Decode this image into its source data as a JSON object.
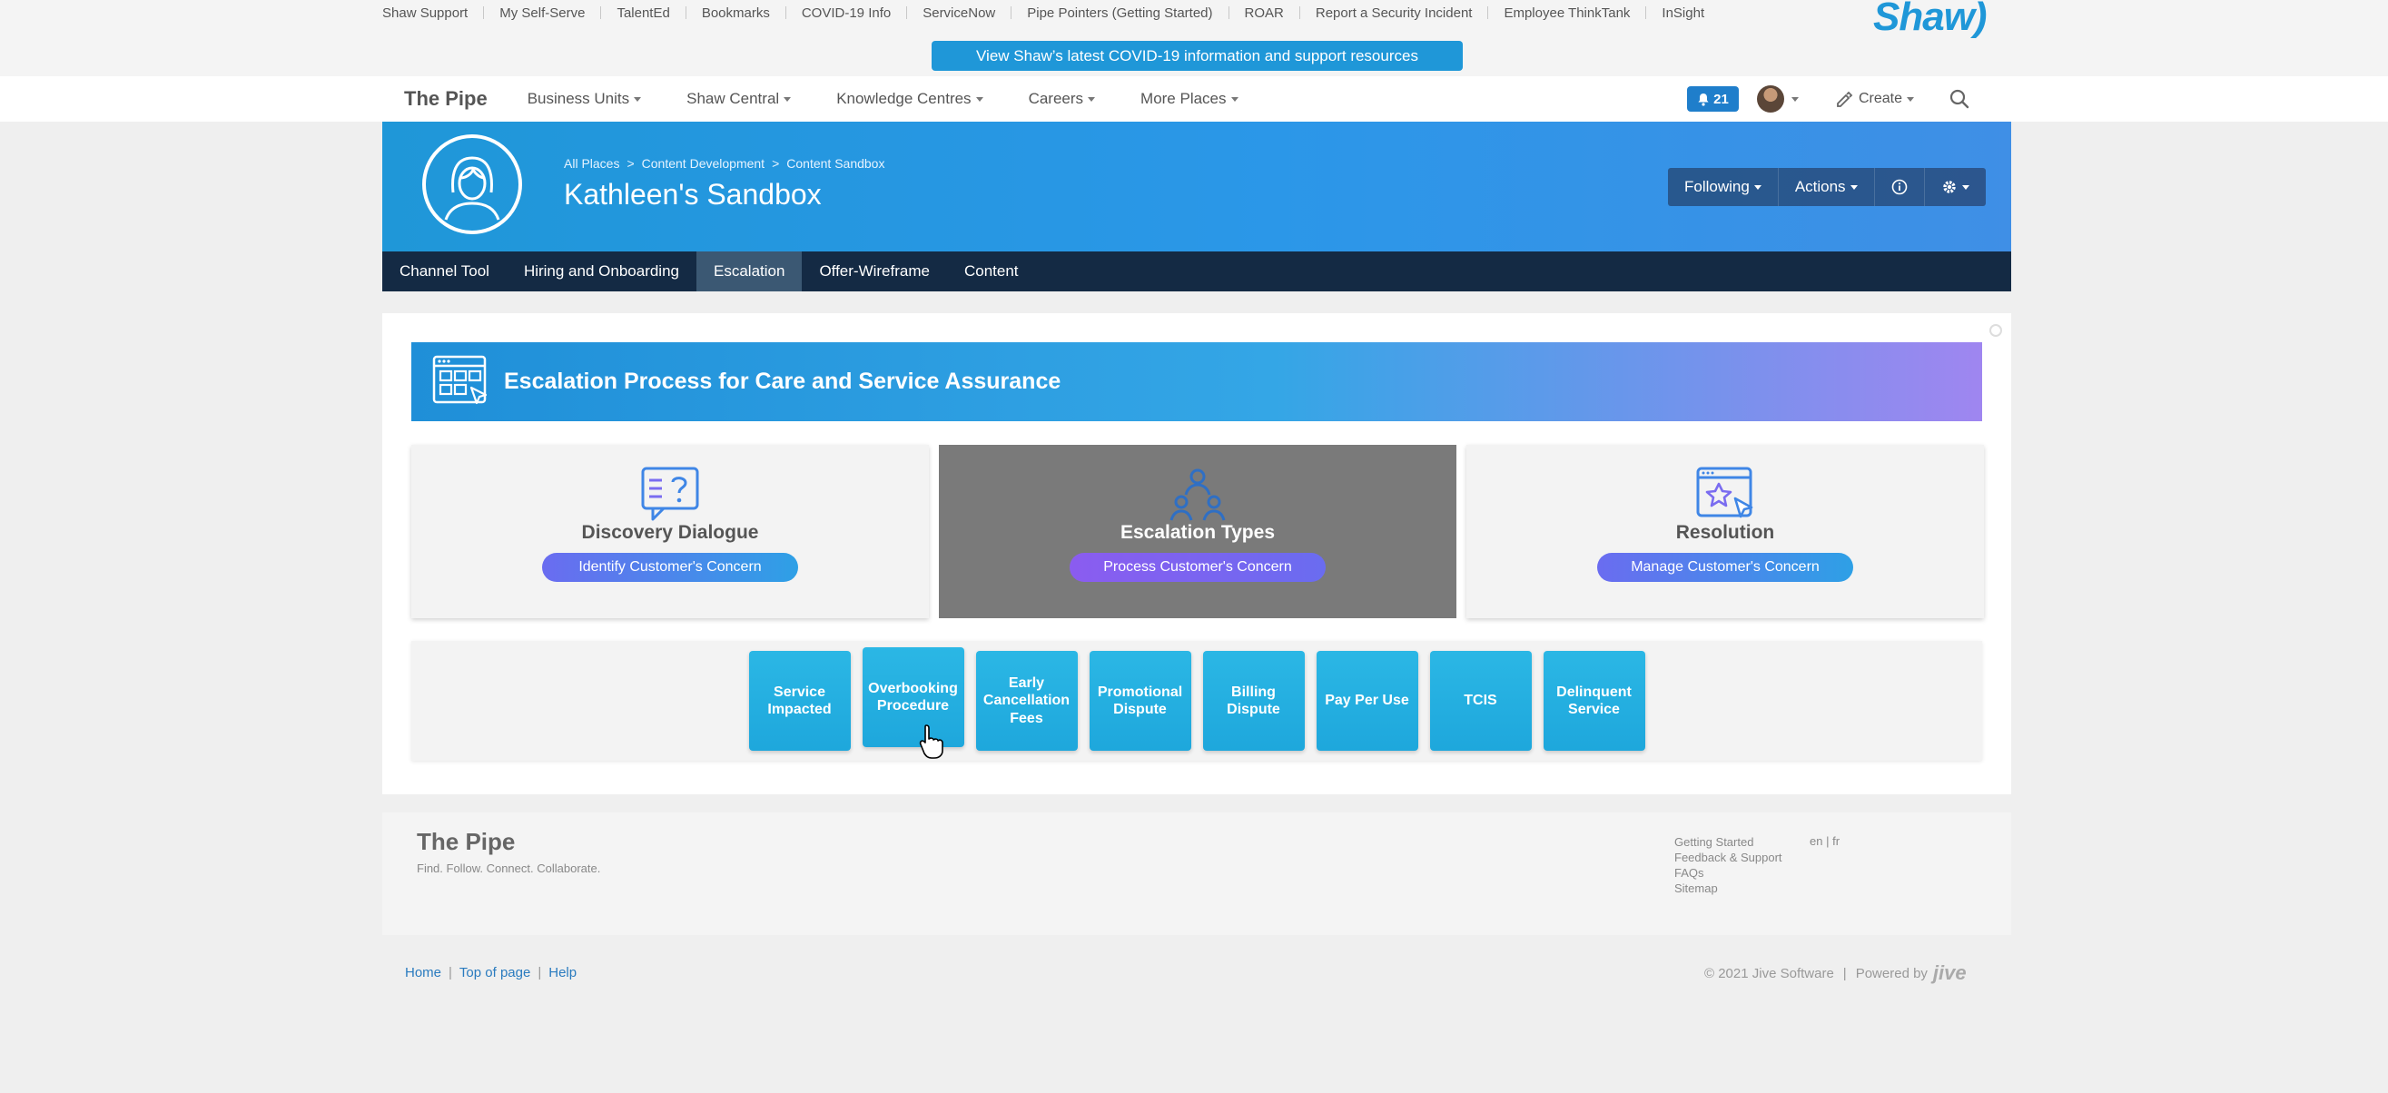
{
  "utility_links": [
    "Shaw Support",
    "My Self-Serve",
    "TalentEd",
    "Bookmarks",
    "COVID-19 Info",
    "ServiceNow",
    "Pipe Pointers (Getting Started)",
    "ROAR",
    "Report a Security Incident",
    "Employee ThinkTank",
    "InSight"
  ],
  "logo_text": "Shaw)",
  "covid_banner": "View Shaw’s latest COVID-19 information and support resources",
  "nav": {
    "brand": "The Pipe",
    "items": [
      "Business Units",
      "Shaw Central",
      "Knowledge Centres",
      "Careers",
      "More Places"
    ],
    "notifications": "21",
    "create_label": "Create"
  },
  "place": {
    "breadcrumb": [
      "All Places",
      "Content Development",
      "Content Sandbox"
    ],
    "breadcrumb_sep": ">",
    "title": "Kathleen's Sandbox",
    "actions": {
      "following": "Following",
      "actions": "Actions"
    }
  },
  "tabs": [
    "Channel Tool",
    "Hiring and Onboarding",
    "Escalation",
    "Offer-Wireframe",
    "Content"
  ],
  "active_tab": "Escalation",
  "escalation": {
    "banner_title": "Escalation Process for Care and Service Assurance",
    "cards": [
      {
        "title": "Discovery Dialogue",
        "pill": "Identify Customer's Concern"
      },
      {
        "title": "Escalation Types",
        "pill": "Process Customer's Concern"
      },
      {
        "title": "Resolution",
        "pill": "Manage Customer's Concern"
      }
    ],
    "tiles": [
      {
        "lines": [
          "Service",
          "Impacted"
        ]
      },
      {
        "lines": [
          "Overbooking",
          "Procedure"
        ]
      },
      {
        "lines": [
          "Early",
          "Cancellation",
          "Fees"
        ]
      },
      {
        "lines": [
          "Promotional",
          "Dispute"
        ]
      },
      {
        "lines": [
          "Billing",
          "Dispute"
        ]
      },
      {
        "lines": [
          "Pay Per Use"
        ]
      },
      {
        "lines": [
          "TCIS"
        ]
      },
      {
        "lines": [
          "Delinquent",
          "Service"
        ]
      }
    ]
  },
  "footer": {
    "brand": "The Pipe",
    "tagline": "Find. Follow. Connect. Collaborate.",
    "links": [
      "Getting Started",
      "Feedback & Support",
      "FAQs",
      "Sitemap"
    ],
    "lang_en": "en",
    "lang_fr": "fr"
  },
  "bottom": {
    "links": [
      "Home",
      "Top of page",
      "Help"
    ],
    "copyright": "© 2021 Jive Software",
    "powered_by": "Powered by",
    "powered_brand": "jive"
  },
  "colors": {
    "accent": "#1f97d8",
    "nav_dark": "#142a44",
    "tile": "#1ea7dc"
  }
}
